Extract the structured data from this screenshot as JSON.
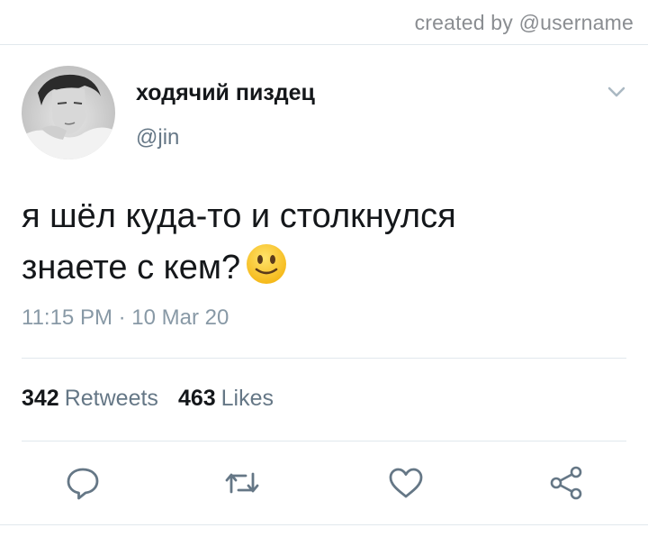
{
  "watermark": "created by @username",
  "tweet": {
    "display_name": "ходячий пиздец",
    "handle": "@jin",
    "text_line1": "я шёл куда-то и столкнулся",
    "text_line2": "знаете с кем?",
    "emoji": "slightly-smiling-face",
    "timestamp": "11:15 PM · 10 Mar 20"
  },
  "stats": {
    "retweets_count": "342",
    "retweets_label": "Retweets",
    "likes_count": "463",
    "likes_label": "Likes"
  },
  "icons": {
    "reply": "reply-icon",
    "retweet": "retweet-icon",
    "like": "heart-icon",
    "share": "share-icon",
    "menu": "chevron-down-icon"
  },
  "colors": {
    "text": "#14171a",
    "secondary": "#657786",
    "timestamp": "#8899a6",
    "icon": "#657786",
    "divider": "#e1e8ed"
  }
}
